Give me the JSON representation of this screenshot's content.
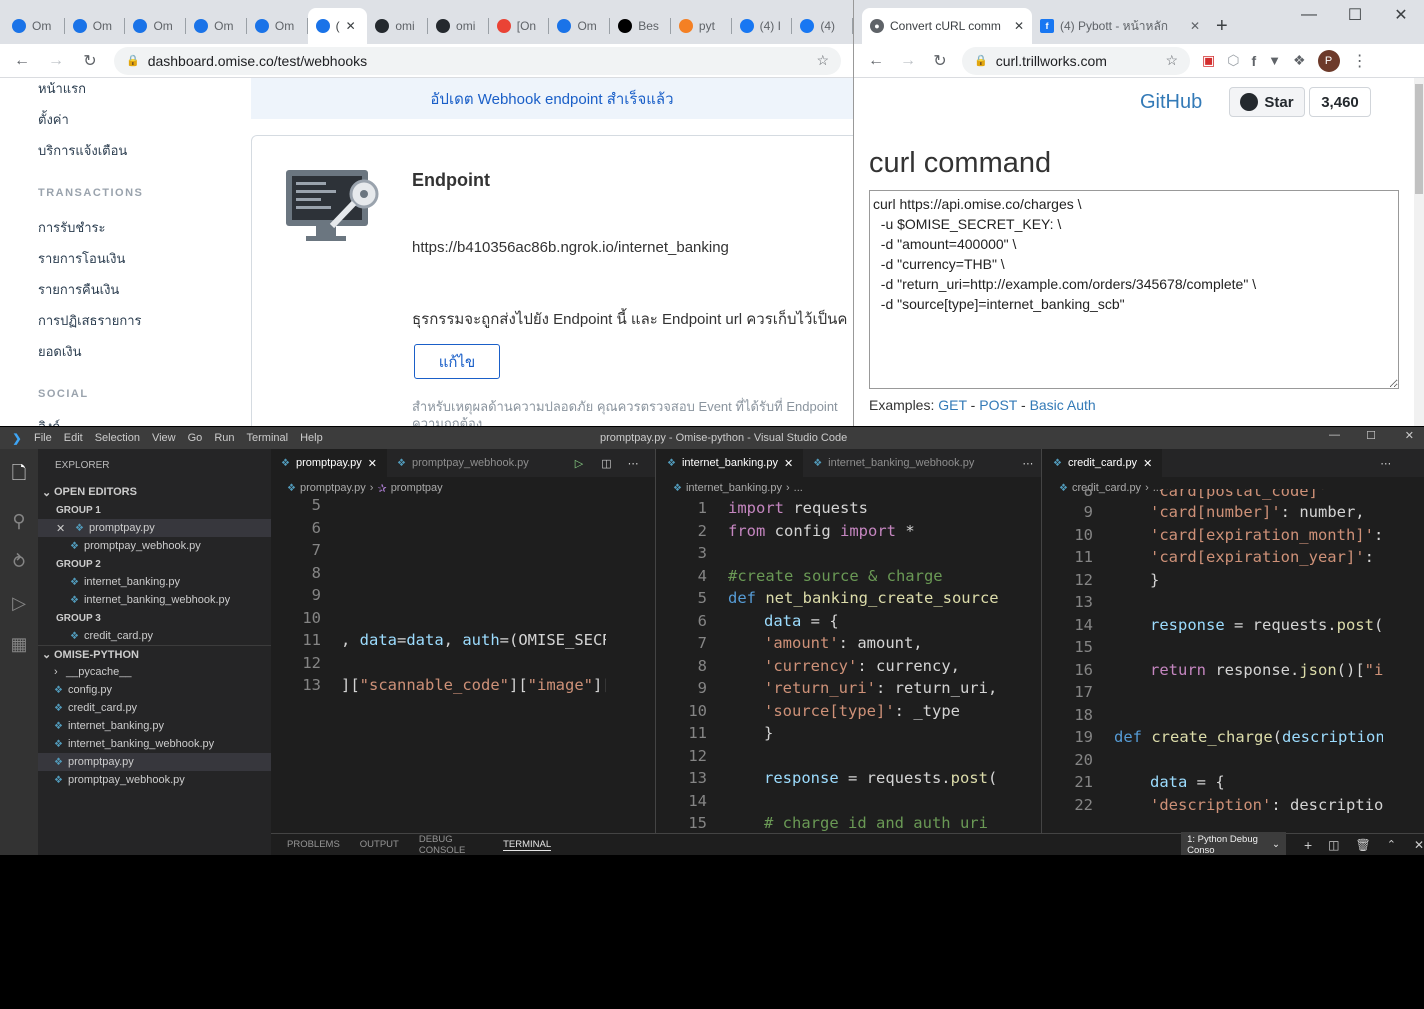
{
  "browser_left": {
    "tabs": [
      {
        "label": "Om",
        "color": "#1a73e8"
      },
      {
        "label": "Om",
        "color": "#1a73e8"
      },
      {
        "label": "Om",
        "color": "#1a73e8"
      },
      {
        "label": "Om",
        "color": "#1a73e8"
      },
      {
        "label": "Om",
        "color": "#1a73e8"
      },
      {
        "label": "(",
        "color": "#1a73e8",
        "active": true
      },
      {
        "label": "omi",
        "color": "#24292e"
      },
      {
        "label": "omi",
        "color": "#24292e"
      },
      {
        "label": "[On",
        "color": "#ea4335"
      },
      {
        "label": "Om",
        "color": "#1a73e8"
      },
      {
        "label": "Bes",
        "color": "#000"
      },
      {
        "label": "pyt",
        "color": "#f48024"
      },
      {
        "label": "(4) I",
        "color": "#1877f2"
      },
      {
        "label": "(4)",
        "color": "#1877f2"
      }
    ],
    "url": "dashboard.omise.co/test/webhooks",
    "sidebar": {
      "top_items": [
        "หน้าแรก",
        "ตั้งค่า",
        "บริการแจ้งเตือน"
      ],
      "transactions_heading": "TRANSACTIONS",
      "transactions_items": [
        "การรับชำระ",
        "รายการโอนเงิน",
        "รายการคืนเงิน",
        "การปฏิเสธรายการ",
        "ยอดเงิน"
      ],
      "social_heading": "SOCIAL",
      "social_partial": "ลิงก์"
    },
    "banner": "อัปเดต Webhook endpoint สำเร็จแล้ว",
    "card": {
      "title": "Endpoint",
      "url": "https://b410356ac86b.ngrok.io/internet_banking",
      "description": "ธุรกรรมจะถูกส่งไปยัง Endpoint นี้ และ Endpoint url ควรเก็บไว้เป็นค",
      "edit_button": "แก้ไข",
      "note_line1": "สำหรับเหตุผลด้านความปลอดภัย คุณควรตรวจสอบ Event ที่ได้รับที่ Endpoint",
      "note_line2": "ความถูกต้อง"
    }
  },
  "browser_right": {
    "tabs": [
      {
        "label": "Convert cURL comm",
        "active": true
      },
      {
        "label": "(4) Pybott - หน้าหลัก"
      }
    ],
    "url": "curl.trillworks.com",
    "profile_initial": "P",
    "github_link": "GitHub",
    "star_label": "Star",
    "star_count": "3,460",
    "heading": "curl command",
    "curl_text": "curl https://api.omise.co/charges \\\n  -u $OMISE_SECRET_KEY: \\\n  -d \"amount=400000\" \\\n  -d \"currency=THB\" \\\n  -d \"return_uri=http://example.com/orders/345678/complete\" \\\n  -d \"source[type]=internet_banking_scb\"",
    "examples_label": "Examples:",
    "examples": [
      "GET",
      "POST",
      "Basic Auth"
    ]
  },
  "vscode": {
    "menu": [
      "File",
      "Edit",
      "Selection",
      "View",
      "Go",
      "Run",
      "Terminal",
      "Help"
    ],
    "title": "promptpay.py - Omise-python - Visual Studio Code",
    "explorer_title": "EXPLORER",
    "open_editors": "OPEN EDITORS",
    "group1": "GROUP 1",
    "group2": "GROUP 2",
    "group3": "GROUP 3",
    "g1_files": [
      "promptpay.py",
      "promptpay_webhook.py"
    ],
    "g2_files": [
      "internet_banking.py",
      "internet_banking_webhook.py"
    ],
    "g3_files": [
      "credit_card.py"
    ],
    "project": "OMISE-PYTHON",
    "project_files": [
      "__pycache__",
      "config.py",
      "credit_card.py",
      "internet_banking.py",
      "internet_banking_webhook.py",
      "promptpay.py",
      "promptpay_webhook.py"
    ],
    "pane1": {
      "tabs": [
        "promptpay.py",
        "promptpay_webhook.py"
      ],
      "crumb": [
        "promptpay.py",
        "promptpay"
      ]
    },
    "pane2": {
      "tabs": [
        "internet_banking.py",
        "internet_banking_webhook.py"
      ],
      "crumb": [
        "internet_banking.py",
        "..."
      ]
    },
    "pane3": {
      "tabs": [
        "credit_card.py"
      ],
      "crumb": [
        "credit_card.py",
        "..."
      ]
    },
    "panel_tabs": [
      "PROBLEMS",
      "OUTPUT",
      "DEBUG CONSOLE",
      "TERMINAL"
    ],
    "terminal_select": "1: Python Debug Conso"
  }
}
